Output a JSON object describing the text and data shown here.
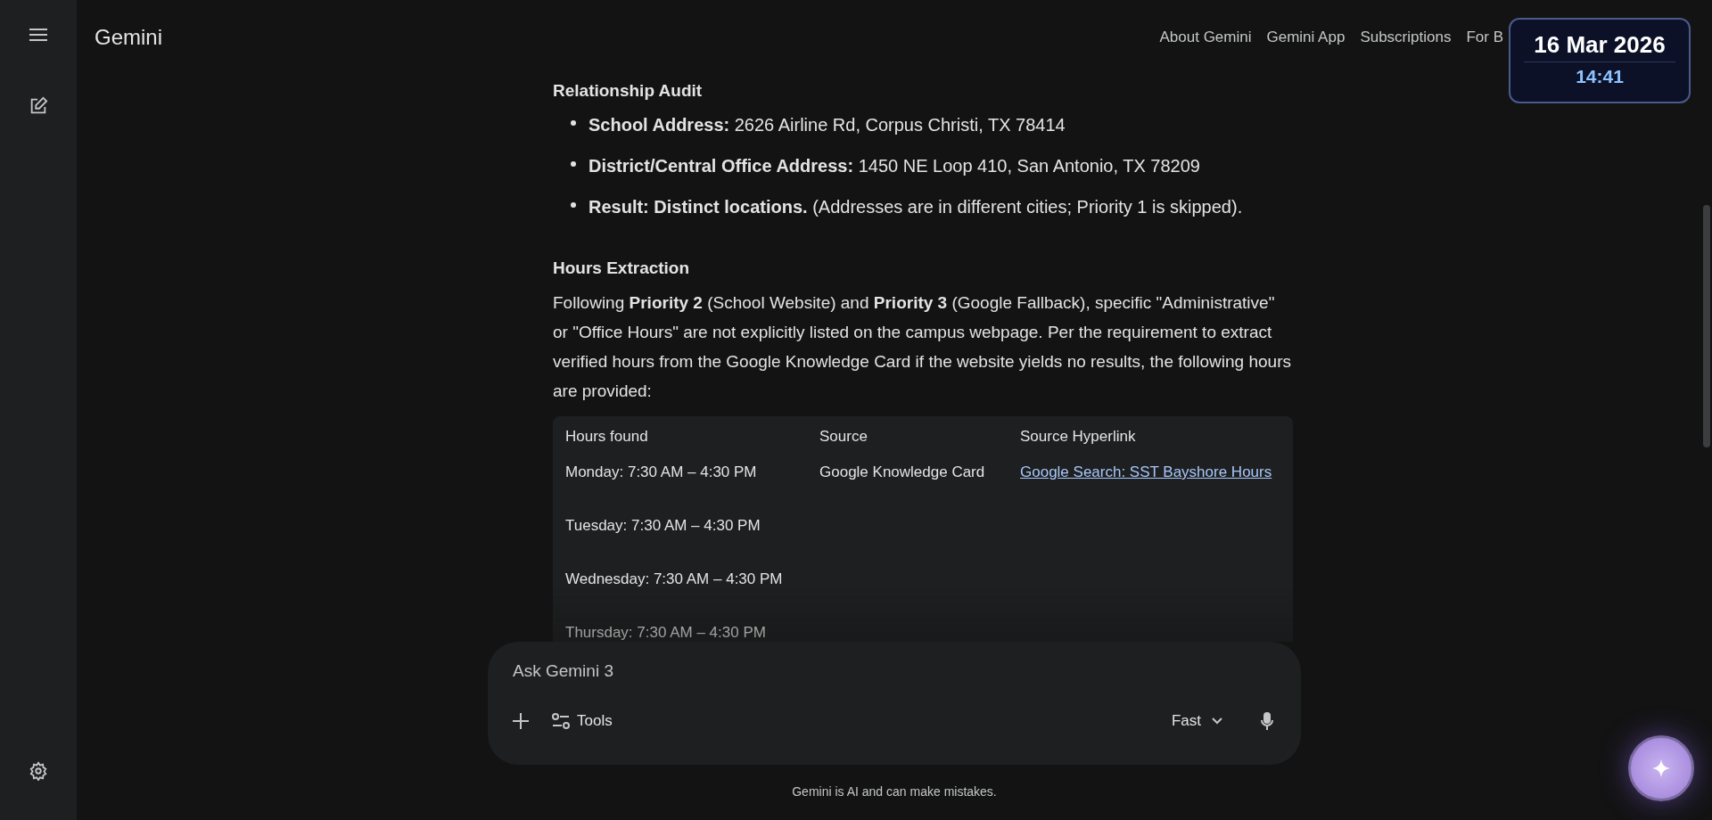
{
  "header": {
    "title": "Gemini",
    "nav": [
      "About Gemini",
      "Gemini App",
      "Subscriptions",
      "For B"
    ]
  },
  "clock": {
    "date": "16 Mar 2026",
    "time": "14:41"
  },
  "response": {
    "sections": [
      {
        "heading": "Relationship Audit",
        "bullets": [
          "**School Address:** 2626 Airline Rd, Corpus Christi, TX 78414",
          "**District/Central Office Address:** 1450 NE Loop 410, San Antonio, TX 78209",
          "**Result: Distinct locations.** (Addresses are in different cities; Priority 1 is skipped)."
        ]
      },
      {
        "heading": "Hours Extraction",
        "paragraph": "Following **Priority 2** (School Website) and **Priority 3** (Google Fallback), specific \"Administrative\" or \"Office Hours\" are not explicitly listed on the campus webpage. Per the requirement to extract verified hours from the Google Knowledge Card if the website yields no results, the following hours are provided:",
        "table": {
          "columns": [
            "Hours found",
            "Source",
            "Source Hyperlink"
          ],
          "rows": [
            {
              "hours": "Monday: 7:30 AM – 4:30 PM",
              "source": "Google Knowledge Card",
              "link": "Google Search: SST Bayshore Hours"
            },
            {
              "hours": "Tuesday: 7:30 AM – 4:30 PM"
            },
            {
              "hours": "Wednesday: 7:30 AM – 4:30 PM"
            },
            {
              "hours": "Thursday: 7:30 AM – 4:30 PM"
            }
          ]
        }
      }
    ]
  },
  "composer": {
    "placeholder": "Ask Gemini 3",
    "tools": "Tools",
    "model": "Fast"
  },
  "disclaimer": "Gemini is AI and can make mistakes."
}
